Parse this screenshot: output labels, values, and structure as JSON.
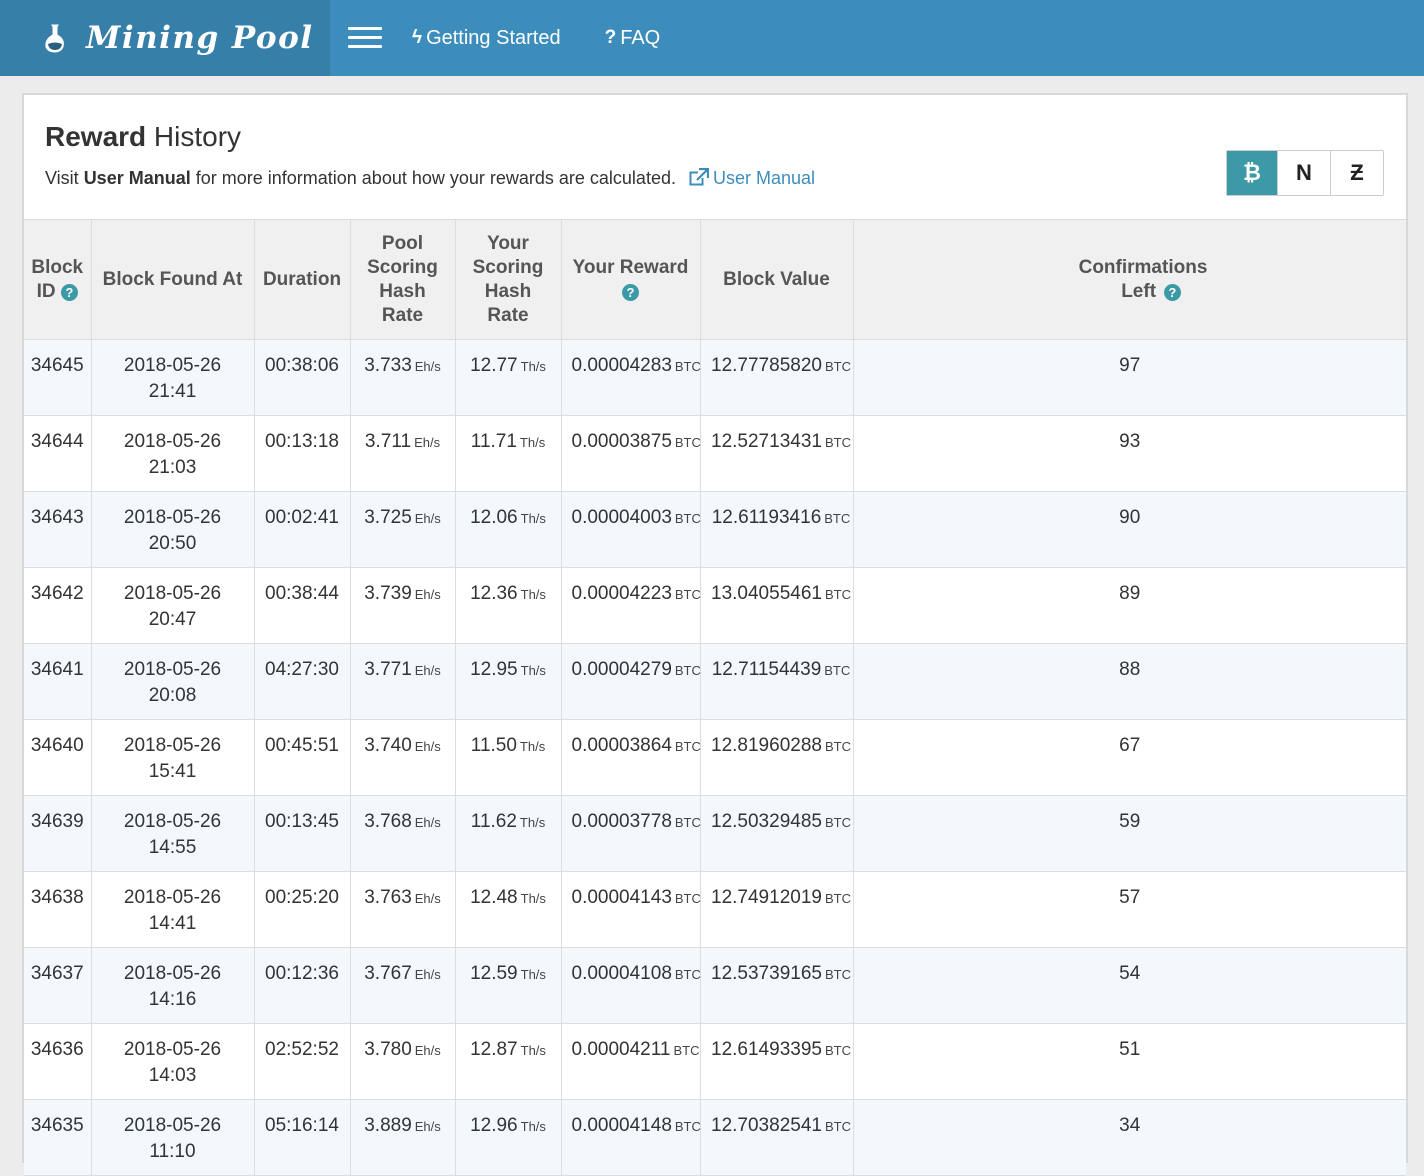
{
  "navbar": {
    "brand": "Mining Pool",
    "links": [
      {
        "label": "Getting Started",
        "icon": "lightning-icon"
      },
      {
        "label": "FAQ",
        "icon": "question-icon"
      }
    ]
  },
  "header": {
    "title_bold": "Reward",
    "title_rest": " History",
    "subtitle_pre": "Visit ",
    "subtitle_bold": "User Manual",
    "subtitle_post": " for more information about how your rewards are calculated.",
    "manual_link": "User Manual"
  },
  "coins": [
    {
      "symbol": "₿",
      "name": "bitcoin-icon",
      "active": true
    },
    {
      "symbol": "N",
      "name": "namecoin-icon",
      "active": false
    },
    {
      "symbol": "Ƶ",
      "name": "zcash-icon",
      "active": false
    }
  ],
  "table": {
    "headers": {
      "block_id": "Block ID",
      "found_at": "Block Found At",
      "duration": "Duration",
      "pool_rate": "Pool Scoring Hash Rate",
      "your_rate": "Your Scoring Hash Rate",
      "reward": "Your Reward",
      "block_value": "Block Value",
      "confirmations": "Confirmations Left"
    },
    "units": {
      "pool": "Eh/s",
      "yours": "Th/s",
      "coin": "BTC"
    },
    "rows": [
      {
        "id": "34645",
        "date": "2018-05-26",
        "time": "21:41",
        "duration": "00:38:06",
        "pool": "3.733",
        "yours": "12.77",
        "reward": "0.00004283",
        "value": "12.77785820",
        "conf": "97"
      },
      {
        "id": "34644",
        "date": "2018-05-26",
        "time": "21:03",
        "duration": "00:13:18",
        "pool": "3.711",
        "yours": "11.71",
        "reward": "0.00003875",
        "value": "12.52713431",
        "conf": "93"
      },
      {
        "id": "34643",
        "date": "2018-05-26",
        "time": "20:50",
        "duration": "00:02:41",
        "pool": "3.725",
        "yours": "12.06",
        "reward": "0.00004003",
        "value": "12.61193416",
        "conf": "90"
      },
      {
        "id": "34642",
        "date": "2018-05-26",
        "time": "20:47",
        "duration": "00:38:44",
        "pool": "3.739",
        "yours": "12.36",
        "reward": "0.00004223",
        "value": "13.04055461",
        "conf": "89"
      },
      {
        "id": "34641",
        "date": "2018-05-26",
        "time": "20:08",
        "duration": "04:27:30",
        "pool": "3.771",
        "yours": "12.95",
        "reward": "0.00004279",
        "value": "12.71154439",
        "conf": "88"
      },
      {
        "id": "34640",
        "date": "2018-05-26",
        "time": "15:41",
        "duration": "00:45:51",
        "pool": "3.740",
        "yours": "11.50",
        "reward": "0.00003864",
        "value": "12.81960288",
        "conf": "67"
      },
      {
        "id": "34639",
        "date": "2018-05-26",
        "time": "14:55",
        "duration": "00:13:45",
        "pool": "3.768",
        "yours": "11.62",
        "reward": "0.00003778",
        "value": "12.50329485",
        "conf": "59"
      },
      {
        "id": "34638",
        "date": "2018-05-26",
        "time": "14:41",
        "duration": "00:25:20",
        "pool": "3.763",
        "yours": "12.48",
        "reward": "0.00004143",
        "value": "12.74912019",
        "conf": "57"
      },
      {
        "id": "34637",
        "date": "2018-05-26",
        "time": "14:16",
        "duration": "00:12:36",
        "pool": "3.767",
        "yours": "12.59",
        "reward": "0.00004108",
        "value": "12.53739165",
        "conf": "54"
      },
      {
        "id": "34636",
        "date": "2018-05-26",
        "time": "14:03",
        "duration": "02:52:52",
        "pool": "3.780",
        "yours": "12.87",
        "reward": "0.00004211",
        "value": "12.61493395",
        "conf": "51"
      },
      {
        "id": "34635",
        "date": "2018-05-26",
        "time": "11:10",
        "duration": "05:16:14",
        "pool": "3.889",
        "yours": "12.96",
        "reward": "0.00004148",
        "value": "12.70382541",
        "conf": "34"
      }
    ]
  },
  "colors": {
    "navbar": "#3c8dbc",
    "brand_bg": "#367fa9",
    "accent": "#3c9aa6",
    "link": "#3c8dbc"
  }
}
